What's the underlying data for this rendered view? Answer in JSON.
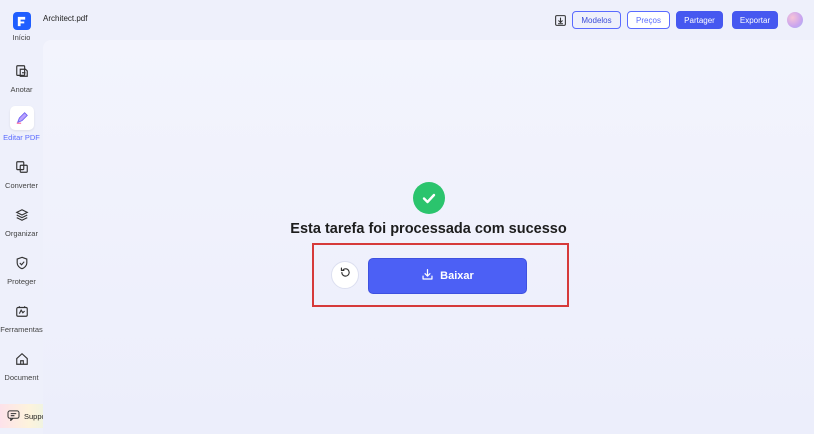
{
  "app": {
    "document_title": "Architect.pdf"
  },
  "sidebar": {
    "items": [
      {
        "label": "Início",
        "icon": "app-logo-icon"
      },
      {
        "label": "Anotar",
        "icon": "annotate-icon"
      },
      {
        "label": "Editar PDF",
        "icon": "edit-pdf-icon",
        "active": true
      },
      {
        "label": "Converter",
        "icon": "convert-icon"
      },
      {
        "label": "Organizar",
        "icon": "layers-icon"
      },
      {
        "label": "Proteger",
        "icon": "shield-icon"
      },
      {
        "label": "Ferramentas",
        "icon": "tools-icon"
      },
      {
        "label": "Document",
        "icon": "home-icon"
      }
    ],
    "support_label": "Support"
  },
  "header": {
    "buttons": {
      "modelos": "Modelos",
      "precos": "Preços",
      "partager": "Partager",
      "exportar": "Exportar"
    }
  },
  "main": {
    "success_message": "Esta tarefa foi processada com sucesso",
    "download_label": "Baixar"
  },
  "colors": {
    "accent": "#4c60f5",
    "success": "#2bc46d",
    "highlight": "#d63a3a"
  }
}
